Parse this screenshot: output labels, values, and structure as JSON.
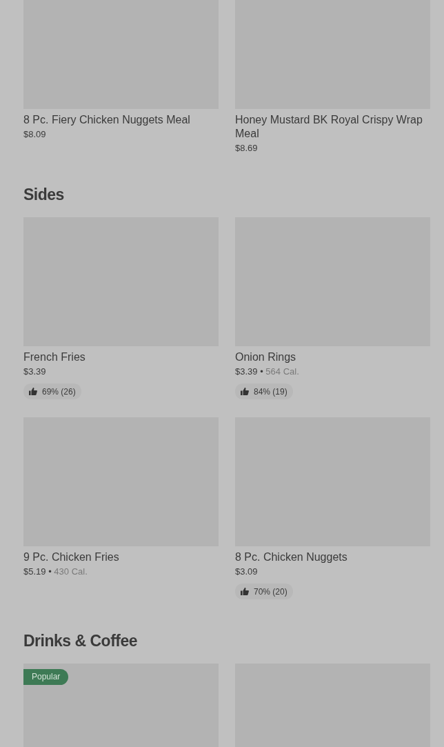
{
  "sections": [
    {
      "items": [
        {
          "kind": "picture",
          "name": "8 Pc. Fiery Chicken Nuggets Meal",
          "price": "$8.09"
        },
        {
          "kind": "picture",
          "name": "Honey Mustard BK Royal Crispy Wrap Meal",
          "price": "$8.69"
        }
      ]
    },
    {
      "title": "Sides",
      "items": [
        {
          "kind": "picture",
          "name": "French Fries",
          "price": "$3.39",
          "rating": "69% (26)"
        },
        {
          "kind": "picture",
          "name": "Onion Rings",
          "price": "$3.39",
          "separator": "•",
          "calories": "564 Cal.",
          "rating": "84% (19)"
        },
        {
          "kind": "picture",
          "name": "9 Pc. Chicken Fries",
          "price": "$5.19",
          "separator": "•",
          "calories": "430 Cal."
        },
        {
          "kind": "picture",
          "name": "8 Pc. Chicken Nuggets",
          "price": "$3.09",
          "rating": "70% (20)"
        }
      ]
    },
    {
      "title": "Drinks & Coffee",
      "items": [
        {
          "kind": "picture",
          "badge": "Popular"
        },
        {
          "kind": "picture"
        }
      ]
    }
  ]
}
